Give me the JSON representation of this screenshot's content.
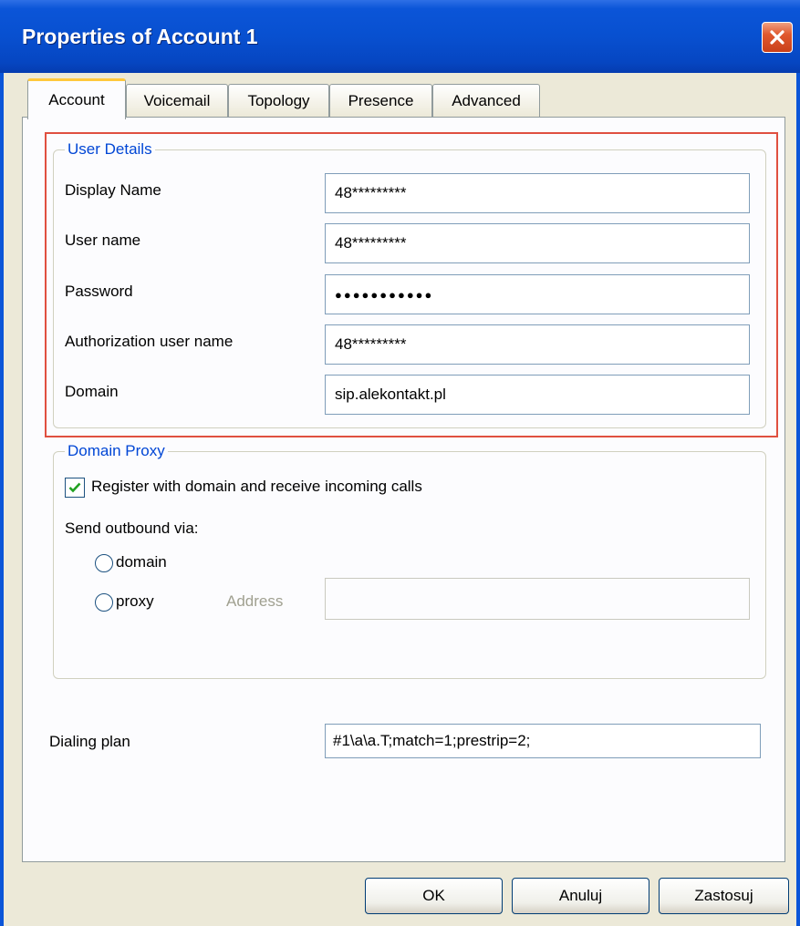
{
  "window": {
    "title": "Properties of Account 1"
  },
  "tabs": [
    {
      "label": "Account",
      "active": true
    },
    {
      "label": "Voicemail"
    },
    {
      "label": "Topology"
    },
    {
      "label": "Presence"
    },
    {
      "label": "Advanced"
    }
  ],
  "user_details": {
    "legend": "User Details",
    "display_name": {
      "label": "Display Name",
      "value": "48*********"
    },
    "user_name": {
      "label": "User name",
      "value": "48*********"
    },
    "password": {
      "label": "Password",
      "value": "●●●●●●●●●●●"
    },
    "auth_user_name": {
      "label": "Authorization user name",
      "value": "48*********"
    },
    "domain": {
      "label": "Domain",
      "value": "sip.alekontakt.pl"
    }
  },
  "domain_proxy": {
    "legend": "Domain Proxy",
    "register_label": "Register with domain and receive incoming calls",
    "register_checked": true,
    "send_outbound_label": "Send outbound via:",
    "radio_domain_label": "domain",
    "radio_proxy_label": "proxy",
    "address_label": "Address",
    "address_value": ""
  },
  "dialing_plan": {
    "label": "Dialing plan",
    "value": "#1\\a\\a.T;match=1;prestrip=2;"
  },
  "buttons": {
    "ok": "OK",
    "cancel": "Anuluj",
    "apply": "Zastosuj"
  },
  "colors": {
    "titlebar": "#0b55d8",
    "legend": "#0046d5",
    "highlight_frame": "#e05040"
  }
}
